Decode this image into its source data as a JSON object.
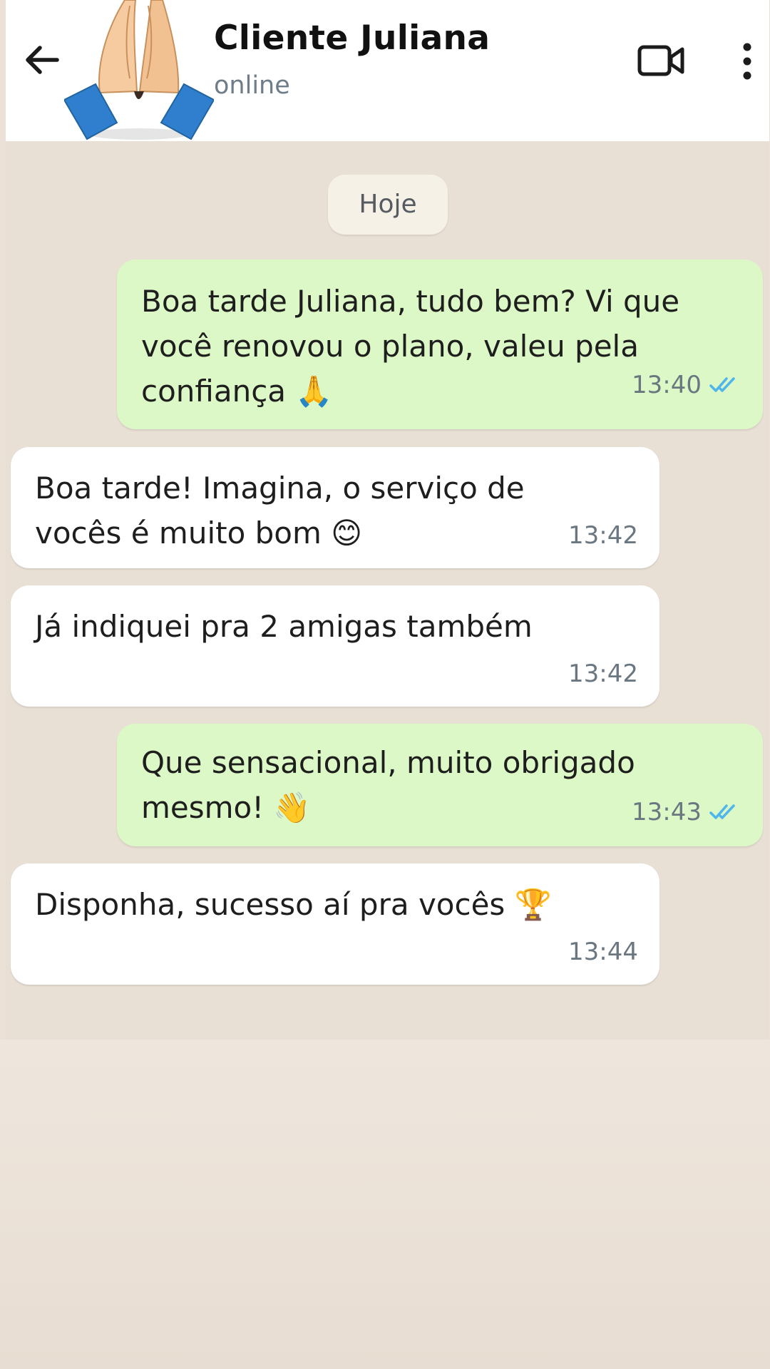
{
  "header": {
    "back_icon": "arrow-left-icon",
    "avatar_icon": "folded-hands-icon",
    "contact_name": "Cliente Juliana",
    "status": "online",
    "video_icon": "video-camera-icon",
    "menu_icon": "more-vertical-icon"
  },
  "chat": {
    "date_chip": "Hoje",
    "messages": [
      {
        "direction": "outgoing",
        "text": "Boa tarde Juliana, tudo bem? Vi que\nvocê renovou o plano, valeu pela\nconfiança 🙏",
        "time": "13:40",
        "status_icon": "double-check-read-icon"
      },
      {
        "direction": "incoming",
        "text": "Boa tarde! Imagina, o serviço de\nvocês é muito bom 😊",
        "time": "13:42"
      },
      {
        "direction": "incoming",
        "text": "Já indiquei pra 2 amigas também",
        "time": "13:42"
      },
      {
        "direction": "outgoing",
        "text": "Que sensacional, muito obrigado\nmesmo! 👋",
        "time": "13:43",
        "status_icon": "double-check-read-icon"
      },
      {
        "direction": "incoming",
        "text": "Disponha, sucesso aí pra vocês 🏆",
        "time": "13:44"
      }
    ]
  },
  "colors": {
    "outgoing_bubble": "#dcf8c6",
    "incoming_bubble": "#ffffff",
    "chat_background": "#e9e0d5",
    "read_ticks": "#4fb6ec"
  }
}
